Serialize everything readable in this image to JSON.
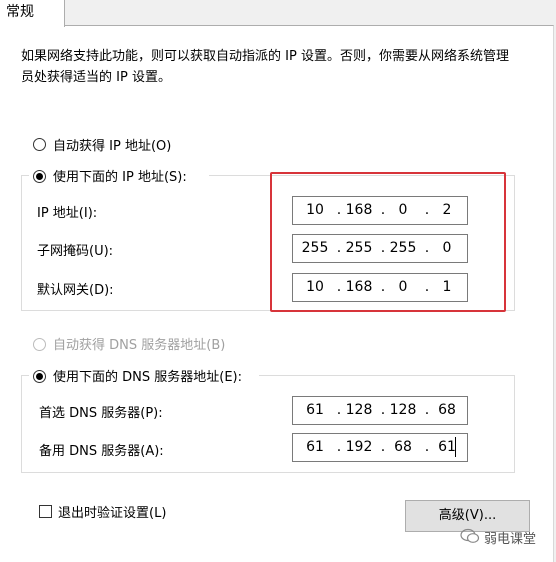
{
  "tab": {
    "label": "常规"
  },
  "description": "如果网络支持此功能，则可以获取自动指派的 IP 设置。否则，你需要从网络系统管理员处获得适当的 IP 设置。",
  "auto_ip": {
    "label": "自动获得 IP 地址(O)",
    "selected": false
  },
  "manual_ip": {
    "label": "使用下面的 IP 地址(S):",
    "selected": true
  },
  "ip_address": {
    "label": "IP 地址(I):",
    "octets": [
      "10",
      "168",
      "0",
      "2"
    ]
  },
  "subnet_mask": {
    "label": "子网掩码(U):",
    "octets": [
      "255",
      "255",
      "255",
      "0"
    ]
  },
  "gateway": {
    "label": "默认网关(D):",
    "octets": [
      "10",
      "168",
      "0",
      "1"
    ]
  },
  "auto_dns": {
    "label": "自动获得 DNS 服务器地址(B)",
    "selected": false,
    "enabled": false
  },
  "manual_dns": {
    "label": "使用下面的 DNS 服务器地址(E):",
    "selected": true
  },
  "preferred_dns": {
    "label": "首选 DNS 服务器(P):",
    "octets": [
      "61",
      "128",
      "128",
      "68"
    ]
  },
  "alternate_dns": {
    "label": "备用 DNS 服务器(A):",
    "octets": [
      "61",
      "192",
      "68",
      "61"
    ]
  },
  "validate_on_exit": {
    "label": "退出时验证设置(L)",
    "checked": false
  },
  "advanced_button": {
    "label": "高级(V)..."
  },
  "watermark": {
    "text": "弱电课堂"
  },
  "colors": {
    "highlight_box": "#d7343a"
  }
}
